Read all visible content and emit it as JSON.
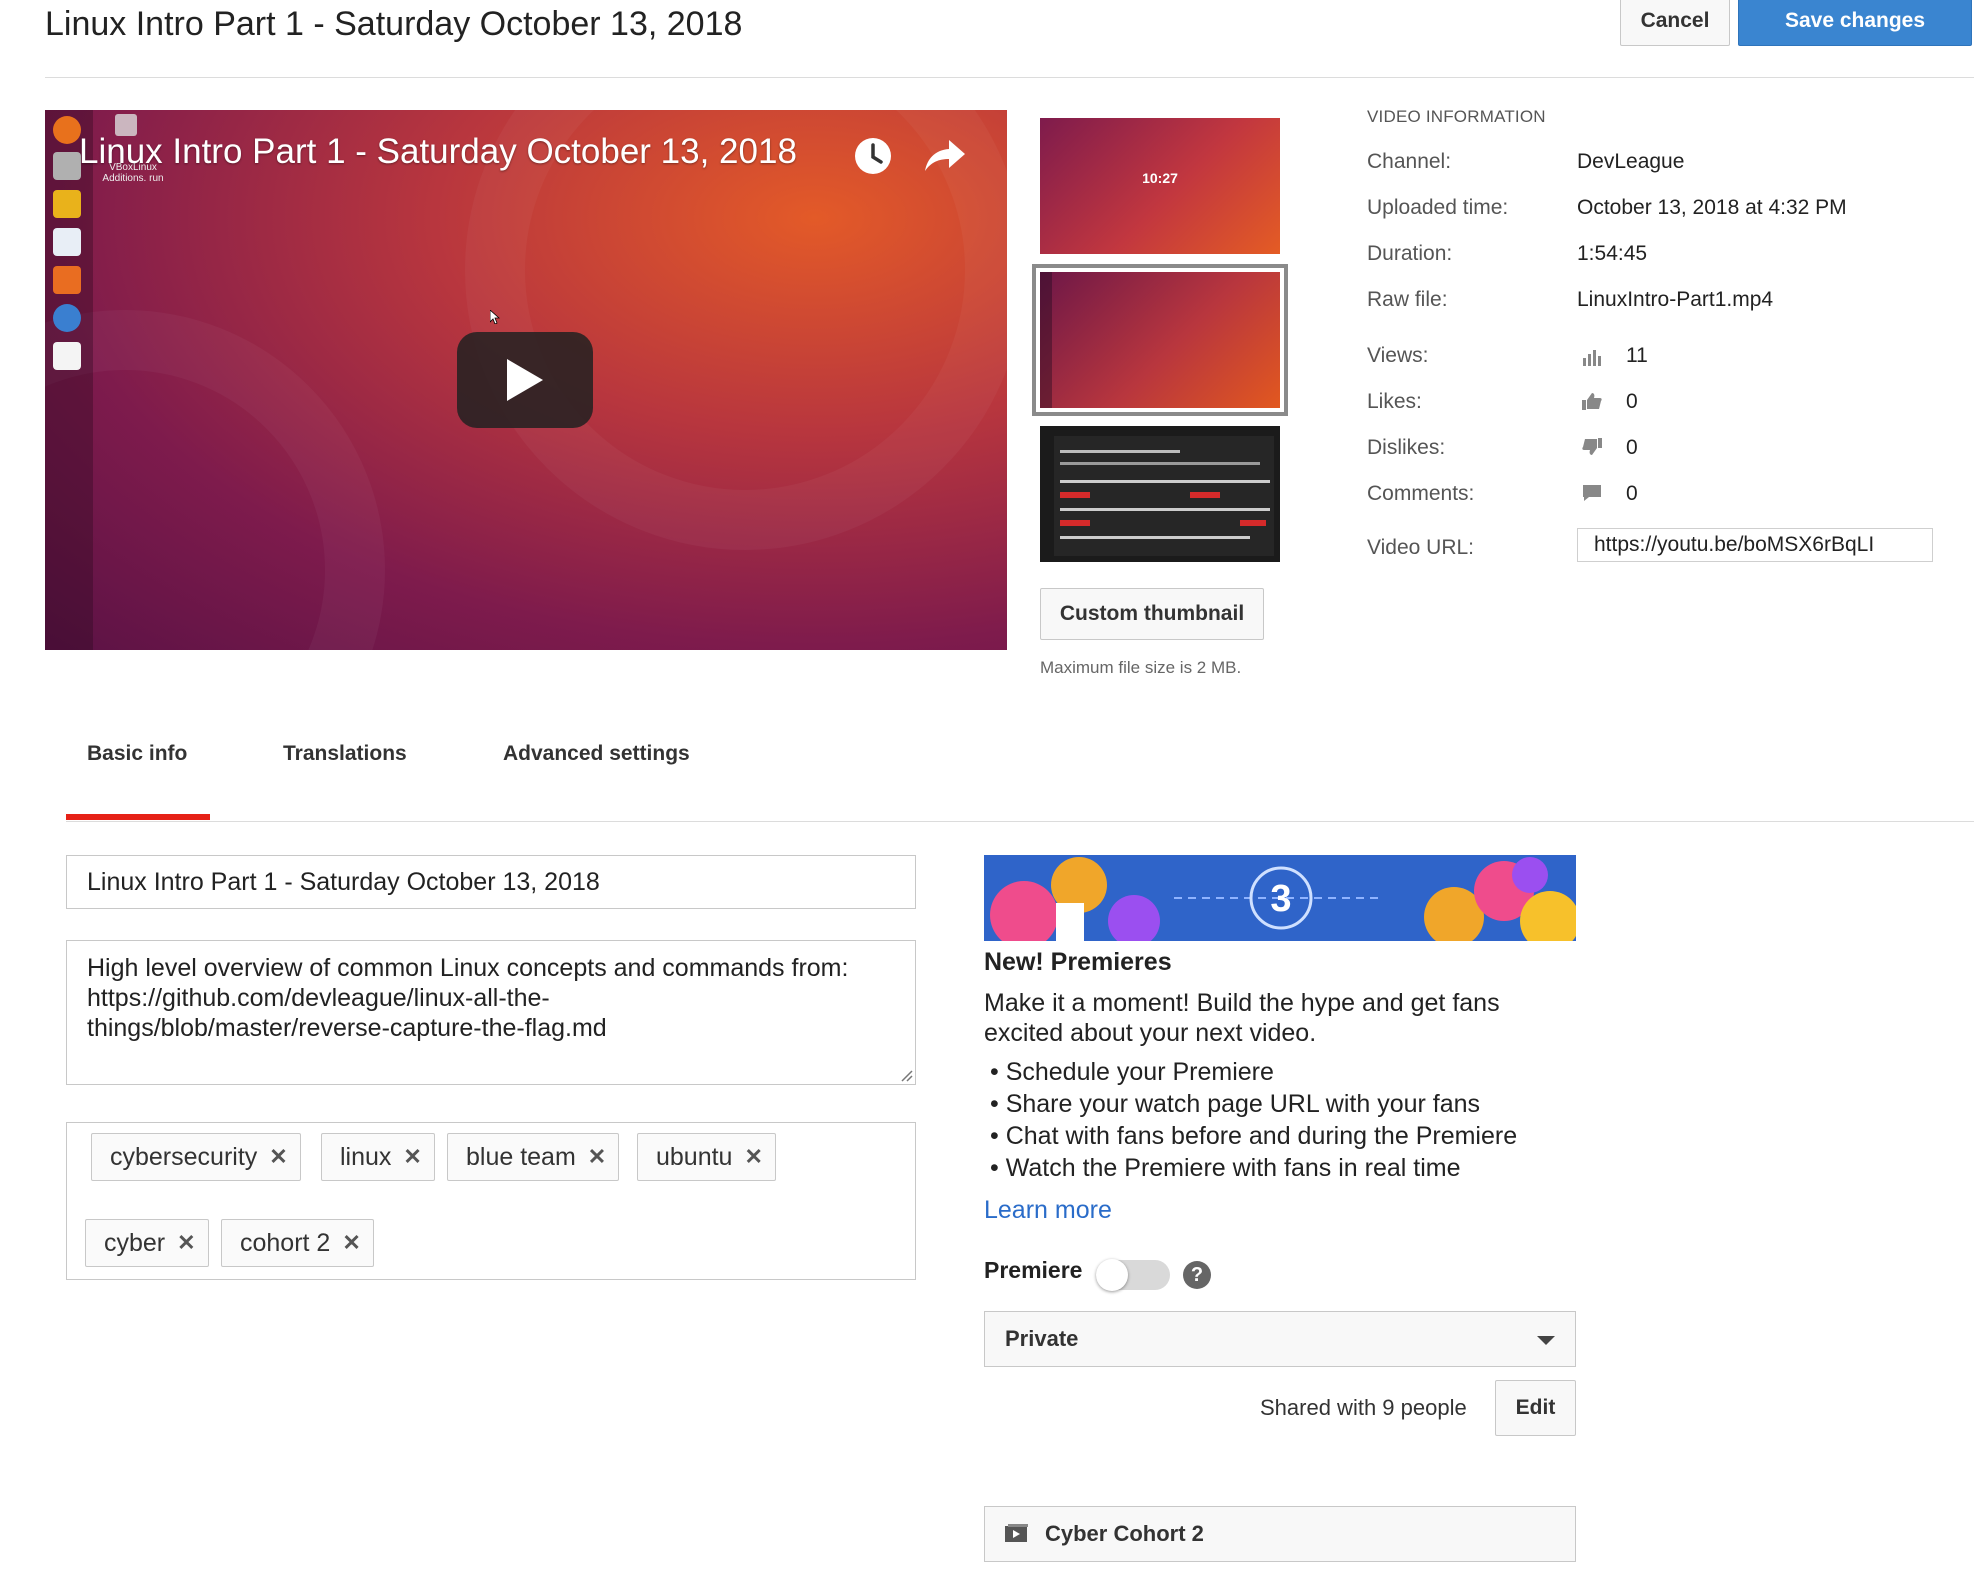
{
  "header": {
    "title": "Linux Intro Part 1 - Saturday October 13, 2018",
    "cancel_label": "Cancel",
    "save_label": "Save changes"
  },
  "player": {
    "title": "Linux Intro Part 1 - Saturday October 13, 2018",
    "icons": [
      "watch-later-icon",
      "share-icon",
      "play-icon"
    ],
    "desktop_file_label": "VBoxLinux Additions. run"
  },
  "thumbnails": {
    "thumb1_clock": "10:27",
    "selected_index": 2,
    "custom_button_label": "Custom thumbnail",
    "note": "Maximum file size is 2 MB."
  },
  "video_info": {
    "heading": "VIDEO INFORMATION",
    "rows": [
      {
        "label": "Channel:",
        "value": "DevLeague"
      },
      {
        "label": "Uploaded time:",
        "value": "October 13, 2018 at 4:32 PM"
      },
      {
        "label": "Duration:",
        "value": "1:54:45"
      },
      {
        "label": "Raw file:",
        "value": "LinuxIntro-Part1.mp4"
      }
    ],
    "stats": [
      {
        "label": "Views:",
        "value": "11",
        "icon": "bar-chart-icon"
      },
      {
        "label": "Likes:",
        "value": "0",
        "icon": "thumbs-up-icon"
      },
      {
        "label": "Dislikes:",
        "value": "0",
        "icon": "thumbs-down-icon"
      },
      {
        "label": "Comments:",
        "value": "0",
        "icon": "comment-icon"
      }
    ],
    "url_label": "Video URL:",
    "url_value": "https://youtu.be/boMSX6rBqLI"
  },
  "tabs": [
    {
      "label": "Basic info",
      "active": true
    },
    {
      "label": "Translations",
      "active": false
    },
    {
      "label": "Advanced settings",
      "active": false
    }
  ],
  "form": {
    "title_value": "Linux Intro Part 1 - Saturday October 13, 2018",
    "description_lines": [
      "High level overview of common Linux concepts and commands from:",
      "https://github.com/devleague/linux-all-the-",
      "things/blob/master/reverse-capture-the-flag.md"
    ],
    "tags": [
      "cybersecurity",
      "linux",
      "blue team",
      "ubuntu",
      "cyber",
      "cohort 2"
    ]
  },
  "premieres": {
    "banner_number": "3",
    "title": "New! Premieres",
    "text": "Make it a moment! Build the hype and get fans excited about your next video.",
    "bullets": [
      "Schedule your Premiere",
      "Share your watch page URL with your fans",
      "Chat with fans before and during the Premiere",
      "Watch the Premiere with fans in real time"
    ],
    "learn_more": "Learn more",
    "premiere_label": "Premiere",
    "premiere_enabled": false,
    "help_glyph": "?"
  },
  "privacy": {
    "selected": "Private",
    "shared_text": "Shared with 9 people",
    "edit_label": "Edit"
  },
  "playlist": {
    "name": "Cyber Cohort 2"
  },
  "colors": {
    "primary_blue": "#3a85d0",
    "link_blue": "#2a6cc9",
    "tab_active_red": "#e62117"
  }
}
